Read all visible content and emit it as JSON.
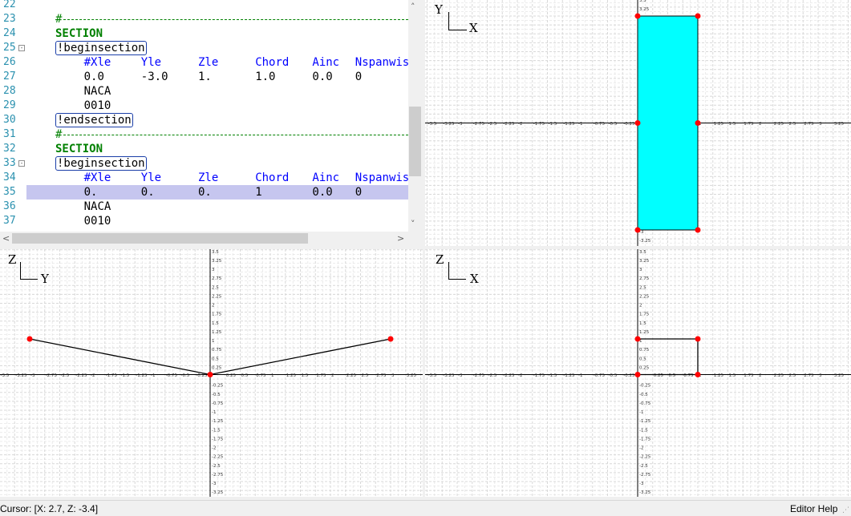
{
  "editor": {
    "lines": [
      {
        "n": "22",
        "tokens": []
      },
      {
        "n": "23",
        "comment": "#",
        "dashes": true
      },
      {
        "n": "24",
        "tokens": [
          {
            "t": "SECTION",
            "c": "kw",
            "col": 0
          }
        ]
      },
      {
        "n": "25",
        "fold": "-",
        "tokens": [
          {
            "t": "!beginsection",
            "c": "tag",
            "col": 0
          }
        ]
      },
      {
        "n": "26",
        "tokens": [
          {
            "t": "#Xle",
            "c": "hdr",
            "col": 4
          },
          {
            "t": "Yle",
            "c": "hdr",
            "col": 12
          },
          {
            "t": "Zle",
            "c": "hdr",
            "col": 20
          },
          {
            "t": "Chord",
            "c": "hdr",
            "col": 28
          },
          {
            "t": "Ainc",
            "c": "hdr",
            "col": 36
          },
          {
            "t": "Nspanwis",
            "c": "hdr",
            "col": 42
          }
        ]
      },
      {
        "n": "27",
        "tokens": [
          {
            "t": "0.0",
            "c": "val",
            "col": 4
          },
          {
            "t": "-3.0",
            "c": "val",
            "col": 12
          },
          {
            "t": "1.",
            "c": "val",
            "col": 20
          },
          {
            "t": "1.0",
            "c": "val",
            "col": 28
          },
          {
            "t": "0.0",
            "c": "val",
            "col": 36
          },
          {
            "t": "0",
            "c": "val",
            "col": 42
          }
        ]
      },
      {
        "n": "28",
        "tokens": [
          {
            "t": "NACA",
            "c": "val",
            "col": 4
          }
        ]
      },
      {
        "n": "29",
        "tokens": [
          {
            "t": "0010",
            "c": "val",
            "col": 4
          }
        ]
      },
      {
        "n": "30",
        "tokens": [
          {
            "t": "!endsection",
            "c": "tag",
            "col": 0
          }
        ]
      },
      {
        "n": "31",
        "comment": "#",
        "dashes": true
      },
      {
        "n": "32",
        "tokens": [
          {
            "t": "SECTION",
            "c": "kw",
            "col": 0
          }
        ]
      },
      {
        "n": "33",
        "fold": "-",
        "tokens": [
          {
            "t": "!beginsection",
            "c": "tag",
            "col": 0
          }
        ]
      },
      {
        "n": "34",
        "tokens": [
          {
            "t": "#Xle",
            "c": "hdr",
            "col": 4
          },
          {
            "t": "Yle",
            "c": "hdr",
            "col": 12
          },
          {
            "t": "Zle",
            "c": "hdr",
            "col": 20
          },
          {
            "t": "Chord",
            "c": "hdr",
            "col": 28
          },
          {
            "t": "Ainc",
            "c": "hdr",
            "col": 36
          },
          {
            "t": "Nspanwis",
            "c": "hdr",
            "col": 42
          }
        ]
      },
      {
        "n": "35",
        "highlight": true,
        "tokens": [
          {
            "t": "0.",
            "c": "val",
            "col": 4
          },
          {
            "t": "0.",
            "c": "val",
            "col": 12
          },
          {
            "t": "0.",
            "c": "val",
            "col": 20
          },
          {
            "t": "1",
            "c": "val",
            "col": 28
          },
          {
            "t": "0.0",
            "c": "val",
            "col": 36
          },
          {
            "t": "0",
            "c": "val",
            "col": 42
          }
        ]
      },
      {
        "n": "36",
        "tokens": [
          {
            "t": "NACA",
            "c": "val",
            "col": 4
          }
        ]
      },
      {
        "n": "37",
        "tokens": [
          {
            "t": "0010",
            "c": "val",
            "col": 4
          }
        ]
      }
    ]
  },
  "scroll": {
    "up_icon": "chevron-up-icon",
    "down_icon": "chevron-down-icon",
    "left_icon": "chevron-left-icon",
    "right_icon": "chevron-right-icon"
  },
  "views": {
    "top": {
      "horizontal_axis": "X",
      "vertical_axis": "Y"
    },
    "front": {
      "horizontal_axis": "Y",
      "vertical_axis": "Z"
    },
    "side": {
      "horizontal_axis": "X",
      "vertical_axis": "Z"
    }
  },
  "grid": {
    "range": [
      -3.5,
      3.5
    ],
    "h_ticks": [
      "-3.5",
      "-3.25",
      "-3",
      "-2.75",
      "-2.5",
      "-2.25",
      "-2",
      "-1.75",
      "-1.5",
      "-1.25",
      "-1",
      "-0.75",
      "-0.5",
      "-0.25",
      "0.25",
      "0.5",
      "0.75",
      "1",
      "1.25",
      "1.5",
      "1.75",
      "2",
      "2.25",
      "2.5",
      "2.75",
      "3",
      "3.25"
    ],
    "v_ticks": [
      "3.5",
      "3.25",
      "3",
      "2.75",
      "2.5",
      "2.25",
      "2",
      "1.75",
      "1.5",
      "1.25",
      "1",
      "0.75",
      "0.5",
      "0.25",
      "-0.25",
      "-0.5",
      "-0.75",
      "-1",
      "-1.25",
      "-1.5",
      "-1.75",
      "-2",
      "-2.25",
      "-2.5",
      "-2.75",
      "-3",
      "-3.25"
    ]
  },
  "geometry": {
    "top_view_polygon": [
      [
        0,
        -3
      ],
      [
        1,
        -3
      ],
      [
        1,
        3
      ],
      [
        0,
        3
      ]
    ],
    "top_view_points": [
      [
        0,
        -3
      ],
      [
        1,
        -3
      ],
      [
        1,
        0
      ],
      [
        0,
        0
      ],
      [
        1,
        3
      ],
      [
        0,
        3
      ]
    ],
    "front_view_polyline": [
      [
        -3,
        1
      ],
      [
        0,
        0
      ],
      [
        3,
        1
      ]
    ],
    "side_view_polyline": [
      [
        0,
        1
      ],
      [
        1,
        1
      ],
      [
        1,
        0
      ],
      [
        0,
        0
      ]
    ],
    "fill_color": "#00ffff",
    "point_color": "#ff0000"
  },
  "statusbar": {
    "cursor": "Cursor: [X:   2.7, Z:  -3.4]",
    "help": "Editor Help"
  },
  "colors": {
    "highlight": "#c6c6ef",
    "keyword": "#008000",
    "header": "#0000ff",
    "line_number": "#2b91af",
    "grid": "#d8d8d8"
  }
}
